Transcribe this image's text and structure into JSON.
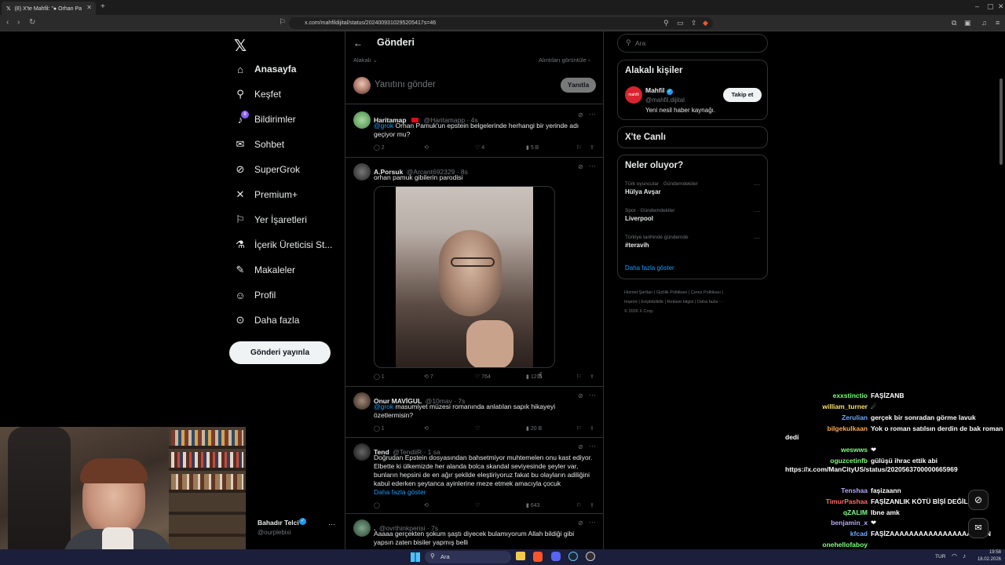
{
  "browser": {
    "tab_title": "(8) X'te Mahfil: \"● Orhan Pa",
    "url": "x.com/mahfildijital/status/2024009310295205417s=46"
  },
  "sidebar": {
    "items": [
      {
        "label": "Anasayfa",
        "icon": "home-icon",
        "glyph": "⌂"
      },
      {
        "label": "Keşfet",
        "icon": "search-icon",
        "glyph": "⚲"
      },
      {
        "label": "Bildirimler",
        "icon": "bell-icon",
        "glyph": "♪"
      },
      {
        "label": "Sohbet",
        "icon": "mail-icon",
        "glyph": "✉"
      },
      {
        "label": "SuperGrok",
        "icon": "grok-icon",
        "glyph": "⊘"
      },
      {
        "label": "Premium+",
        "icon": "x-logo-icon",
        "glyph": "✕"
      },
      {
        "label": "Yer İşaretleri",
        "icon": "bookmark-icon",
        "glyph": "⚐"
      },
      {
        "label": "İçerik Üreticisi St...",
        "icon": "flask-icon",
        "glyph": "⚗"
      },
      {
        "label": "Makaleler",
        "icon": "article-icon",
        "glyph": "✎"
      },
      {
        "label": "Profil",
        "icon": "person-icon",
        "glyph": "☺"
      },
      {
        "label": "Daha fazla",
        "icon": "more-circle-icon",
        "glyph": "⊙"
      }
    ],
    "notification_badge": "8",
    "post_button": "Gönderi yayınla",
    "account_name": "Bahadır Telci",
    "account_handle": "@ourplebixi"
  },
  "center": {
    "header_title": "Gönderi",
    "filter_left": "Alakalı",
    "filter_right": "Alıntıları görüntüle",
    "reply_placeholder": "Yanıtını gönder",
    "reply_button": "Yanıtla",
    "tweets": [
      {
        "name": "Haritamap",
        "handle": "@Haritamapp · 4s",
        "mention": "@grok",
        "text": " Orhan Pamuk'un epstein belgelerinde  herhangi bir yerinde adı geçiyor mu?",
        "replies": "2",
        "retweets": "",
        "likes": "4",
        "views": "5 B"
      },
      {
        "name": "A.Porsuk",
        "handle": "@Arcant692329 · 8s",
        "mention": "",
        "text": "orhan pamuk gibilerin parodisi",
        "replies": "1",
        "retweets": "7",
        "likes": "764",
        "views": "12 B"
      },
      {
        "name": "Onur MAVİGUL",
        "handle": "@10mav · 7s",
        "mention": "@grok",
        "text": " masumiyet müzesi romanında anlatılan sapık hikayeyi özetlermisin?",
        "replies": "1",
        "retweets": "",
        "likes": "",
        "views": "20 B"
      },
      {
        "name": "Tend",
        "handle": "@TendiiR · 1 sa",
        "mention": "",
        "text": "Doğrudan Epstein dosyasından bahsetmiyor muhtemelen onu kast ediyor. Elbette ki ülkemizde her alanda bolca skandal seviyesinde şeyler var, bunların hepsini de en ağır şekilde eleştiriyoruz fakat bu olayların adiliğini kabul ederken şeytanca ayinlerine meze etmek amacıyla çocuk",
        "show_more": "Daha fazla göster",
        "replies": "",
        "retweets": "",
        "likes": "",
        "views": "643"
      },
      {
        "name": ".",
        "handle": "@ovrthinkperisi · 7s",
        "mention": "",
        "text": "Aaaaa gerçekten şokum şaştı diyecek bulamıyorum Allah bildiği gibi yapsın zaten bisiler yapmış belli"
      }
    ]
  },
  "right": {
    "search_placeholder": "Ara",
    "related_title": "Alakalı kişiler",
    "related_name": "Mahfil",
    "related_handle": "@mahfil.dijital",
    "related_bio": "Yeni nesil haber kaynağı.",
    "related_avatar_text": "mahfil",
    "follow_button": "Takip et",
    "live_title": "X'te Canlı",
    "trends_title": "Neler oluyor?",
    "trends": [
      {
        "context": "Türk oyuncular · Gündemdekiler",
        "name": "Hülya Avşar"
      },
      {
        "context": "Spor · Gündemdekiler",
        "name": "Liverpool"
      },
      {
        "context": "Türkiye tarihinde gündemde",
        "name": "#teravih"
      }
    ],
    "show_more": "Daha fazla göster",
    "footer_line1": [
      "Hizmet Şartları",
      "Gizlilik Politikası",
      "Çerez Politikası"
    ],
    "footer_line2": [
      "Imprint",
      "Erişilebilirlik",
      "Reklam bilgisi",
      "Daha fazla ···"
    ],
    "copyright": "© 2026 X Corp."
  },
  "chat": [
    {
      "user": "exxstinctio",
      "color": "#7fff7f",
      "msg": "FAŞİZANB"
    },
    {
      "user": "william_turner",
      "color": "#ffe066",
      "msg": "☄"
    },
    {
      "user": "Zerulian",
      "color": "#6fa8ff",
      "msg": "gerçek bir sonradan görme lavuk"
    },
    {
      "user": "bilgekulkaan",
      "color": "#ffa94d",
      "msg": "Yok o roman satılsın derdin de bak roman dedi"
    },
    {
      "user": "weswws",
      "color": "#7fff7f",
      "msg": "❤"
    },
    {
      "user": "oguzcetinfb",
      "color": "#7fff7f",
      "msg": "gülüşü ihrac ettik abi https://x.com/ManCityUS/status/2020563700000665969"
    },
    {
      "user": "Tenshaa",
      "color": "#b8a6ff",
      "msg": "faşizaann"
    },
    {
      "user": "TimurPashaa",
      "color": "#ff6b6b",
      "msg": "FAŞİZANLIK KÖTÜ BİŞİ DEĞİL AĞ"
    },
    {
      "user": "qZALIM",
      "color": "#7fff7f",
      "msg": "Ibne amk"
    },
    {
      "user": "benjamin_x",
      "color": "#b8a6ff",
      "msg": "❤"
    },
    {
      "user": "kfcad",
      "color": "#6fa8ff",
      "msg": "FAŞİZAAAAAAAAAAAAAAAAAAAAN"
    },
    {
      "user": "onehellofaboy",
      "color": "#7fff7f",
      "msg": ""
    }
  ],
  "taskbar": {
    "search": "Ara",
    "language": "TUR",
    "time": "19:58",
    "date": "18.02.2026"
  }
}
